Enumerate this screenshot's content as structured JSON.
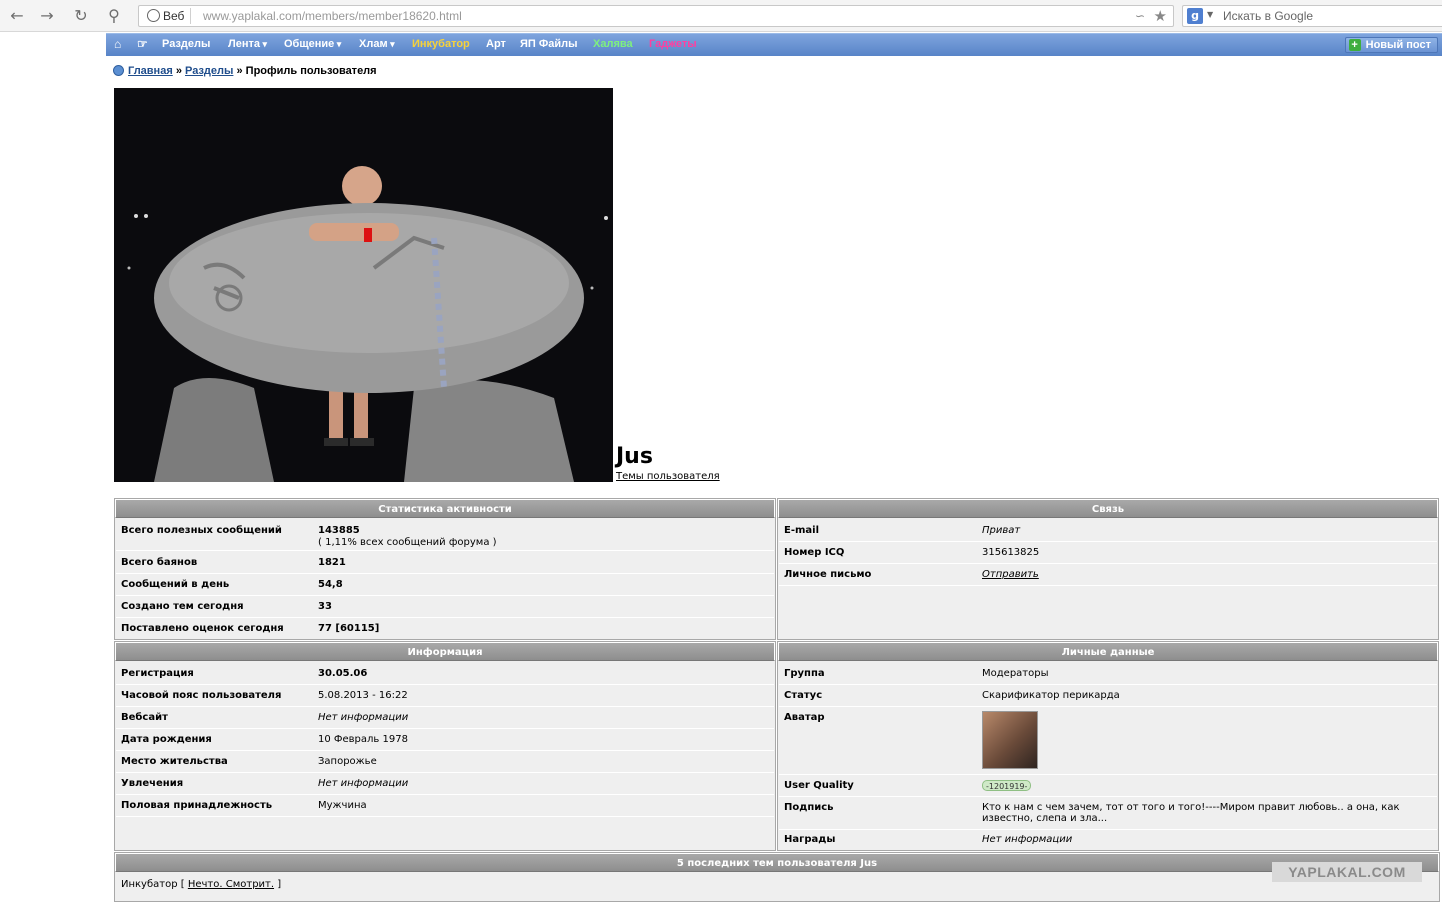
{
  "browser": {
    "web_button": "Веб",
    "url_host": "www.yaplakal.com",
    "url_path": "/members/member18620.html",
    "search_placeholder": "Искать в Google"
  },
  "navbar": {
    "items": [
      "Разделы",
      "Лента",
      "Общение",
      "Хлам",
      "Инкубатор",
      "Арт",
      "ЯП Файлы",
      "Халява",
      "Гаджеты"
    ],
    "colors": {
      "Инкубатор": "#f6d23a",
      "Халява": "#7ef07e",
      "Гаджеты": "#ff3fa0",
      "default": "#ffffff"
    },
    "new_post": "Новый пост"
  },
  "breadcrumb": {
    "home": "Главная",
    "sections": "Разделы",
    "sep": "»",
    "current": "Профиль пользователя"
  },
  "profile": {
    "name": "Jus",
    "themes_link": "Темы пользователя"
  },
  "stats": {
    "title": "Статистика активности",
    "rows": [
      {
        "k": "Всего полезных сообщений",
        "v": "143885",
        "v2": "( 1,11% всех сообщений форума )"
      },
      {
        "k": "Всего баянов",
        "v": "1821"
      },
      {
        "k": "Сообщений в день",
        "v": "54,8"
      },
      {
        "k": "Создано тем сегодня",
        "v": "33"
      },
      {
        "k": "Поставлено оценок сегодня",
        "v": "77 [60115]"
      }
    ]
  },
  "contact": {
    "title": "Связь",
    "rows": [
      {
        "k": "E-mail",
        "v": "Приват"
      },
      {
        "k": "Номер ICQ",
        "v": "315613825"
      },
      {
        "k": "Личное письмо",
        "v": "Отправить"
      }
    ]
  },
  "info": {
    "title": "Информация",
    "rows": [
      {
        "k": "Регистрация",
        "v": "30.05.06"
      },
      {
        "k": "Часовой пояс пользователя",
        "v": "5.08.2013 - 16:22"
      },
      {
        "k": "Вебсайт",
        "v": "Нет информации"
      },
      {
        "k": "Дата рождения",
        "v": "10 Февраль 1978"
      },
      {
        "k": "Место жительства",
        "v": "Запорожье"
      },
      {
        "k": "Увлечения",
        "v": "Нет информации"
      },
      {
        "k": "Половая принадлежность",
        "v": "Мужчина"
      }
    ]
  },
  "personal": {
    "title": "Личные данные",
    "rows": [
      {
        "k": "Группа",
        "v": "Модераторы"
      },
      {
        "k": "Статус",
        "v": "Скарификатор перикарда"
      },
      {
        "k": "Аватар",
        "v": ""
      },
      {
        "k": "User Quality",
        "v": "-1201919-"
      },
      {
        "k": "Подпись",
        "v": "Кто к нам с чем зачем, тот от того и того!----Миром правит любовь.. а она, как",
        "v2": "известно, слепа и зла..."
      },
      {
        "k": "Награды",
        "v": "Нет информации"
      }
    ]
  },
  "last_topics": {
    "title": "5 последних тем пользователя Jus",
    "section": "Инкубатор",
    "open": "[",
    "topic": "Нечто. Смотрит.",
    "close": "]"
  },
  "watermark": "YAPLAKAL.COM"
}
